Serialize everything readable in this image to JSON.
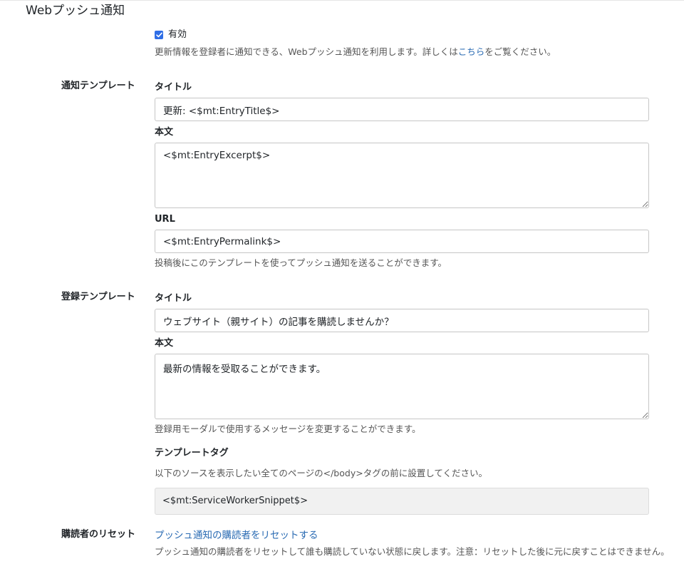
{
  "section": {
    "title": "Webプッシュ通知"
  },
  "enabled": {
    "checked": true,
    "label": "有効",
    "hint_pre": "更新情報を登録者に通知できる、Webプッシュ通知を利用します。詳しくは",
    "hint_link": "こちら",
    "hint_post": "をご覧ください。"
  },
  "notification_template": {
    "label": "通知テンプレート",
    "title_label": "タイトル",
    "title_value": "更新: <$mt:EntryTitle$>",
    "body_label": "本文",
    "body_value": "<$mt:EntryExcerpt$>",
    "url_label": "URL",
    "url_value": "<$mt:EntryPermalink$>",
    "hint": "投稿後にこのテンプレートを使ってプッシュ通知を送ることができます。"
  },
  "registration_template": {
    "label": "登録テンプレート",
    "title_label": "タイトル",
    "title_value": "ウェブサイト（親サイト）の記事を購読しませんか？",
    "body_label": "本文",
    "body_value": "最新の情報を受取ることができます。",
    "hint": "登録用モーダルで使用するメッセージを変更することができます。"
  },
  "template_tag": {
    "label": "テンプレートタグ",
    "hint": "以下のソースを表示したい全てのページの</body>タグの前に設置してください。",
    "snippet": "<$mt:ServiceWorkerSnippet$>"
  },
  "subscriber_reset": {
    "label": "購読者のリセット",
    "link": "プッシュ通知の購読者をリセットする",
    "hint": "プッシュ通知の購読者をリセットして誰も購読していない状態に戻します。注意：リセットした後に元に戻すことはできません。"
  },
  "colors": {
    "checkbox": "#2f6ee6",
    "link": "#2a6bb3",
    "snippet_bg": "#f1f1f1"
  }
}
